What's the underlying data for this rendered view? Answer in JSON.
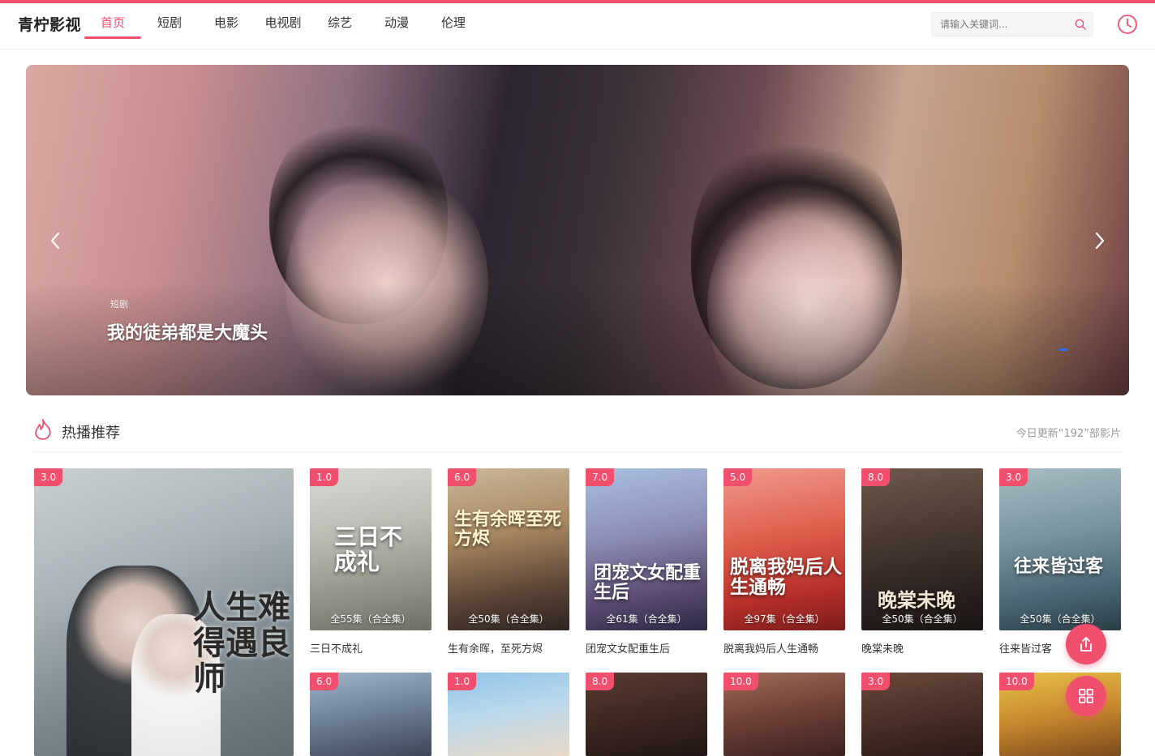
{
  "header": {
    "logo": "青柠影视",
    "nav": [
      {
        "label": "首页",
        "active": true
      },
      {
        "label": "短剧",
        "active": false
      },
      {
        "label": "电影",
        "active": false
      },
      {
        "label": "电视剧",
        "active": false
      },
      {
        "label": "综艺",
        "active": false
      },
      {
        "label": "动漫",
        "active": false
      },
      {
        "label": "伦理",
        "active": false
      }
    ],
    "search_placeholder": "请输入关键词...",
    "search_icon": "search-icon",
    "history_icon": "clock-icon"
  },
  "banner": {
    "tag": "短剧",
    "title": "我的徒弟都是大魔头",
    "prev_icon": "chevron-left-icon",
    "next_icon": "chevron-right-icon"
  },
  "section": {
    "icon": "fire-icon",
    "title": "热播推荐",
    "update_text": "今日更新“192”部影片"
  },
  "featured": {
    "score": "3.0",
    "poster_text": "人生难得遇良师"
  },
  "row1": [
    {
      "score": "1.0",
      "episodes": "全55集（合全集）",
      "title": "三日不成礼",
      "poster_text": "三日不成礼"
    },
    {
      "score": "6.0",
      "episodes": "全50集（合全集）",
      "title": "生有余晖，至死方烬",
      "poster_text": "生有余晖至死方烬"
    },
    {
      "score": "7.0",
      "episodes": "全61集（合全集）",
      "title": "团宠文女配重生后",
      "poster_text": "团宠文女配重生后"
    },
    {
      "score": "5.0",
      "episodes": "全97集（合全集）",
      "title": "脱离我妈后人生通畅",
      "poster_text": "脱离我妈后人生通畅"
    },
    {
      "score": "8.0",
      "episodes": "全50集（合全集）",
      "title": "晚棠未晚",
      "poster_text": "晚棠未晚"
    },
    {
      "score": "3.0",
      "episodes": "全50集（合全集）",
      "title": "往来皆过客",
      "poster_text": "往来皆过客"
    }
  ],
  "row2": [
    {
      "score": "6.0"
    },
    {
      "score": "1.0"
    },
    {
      "score": "8.0"
    },
    {
      "score": "10.0"
    },
    {
      "score": "3.0"
    },
    {
      "score": "10.0"
    }
  ],
  "floating": {
    "share_icon": "share-icon",
    "grid_icon": "grid-icon"
  }
}
